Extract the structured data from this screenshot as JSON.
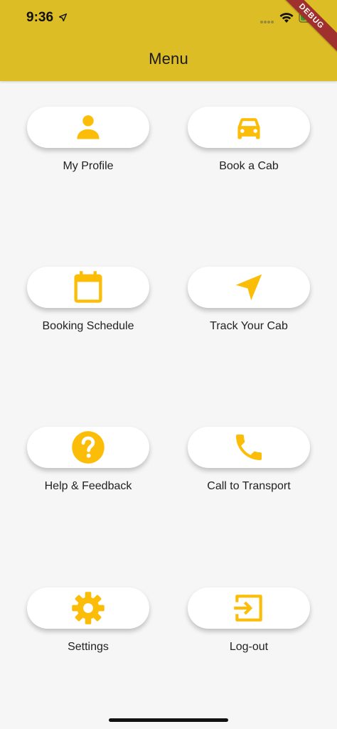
{
  "status_bar": {
    "time": "9:36"
  },
  "app_bar": {
    "title": "Menu"
  },
  "debug_ribbon": "DEBUG",
  "menu": {
    "items": [
      {
        "label": "My Profile",
        "icon": "person-icon"
      },
      {
        "label": "Book a Cab",
        "icon": "car-icon"
      },
      {
        "label": "Booking Schedule",
        "icon": "calendar-icon"
      },
      {
        "label": "Track Your Cab",
        "icon": "navigation-arrow-icon"
      },
      {
        "label": "Help & Feedback",
        "icon": "help-circle-icon"
      },
      {
        "label": "Call to Transport",
        "icon": "phone-icon"
      },
      {
        "label": "Settings",
        "icon": "gear-icon"
      },
      {
        "label": "Log-out",
        "icon": "logout-icon"
      }
    ]
  },
  "colors": {
    "app_bar": "#dcbd26",
    "icon": "#fbbd07",
    "background": "#f6f6f6",
    "debug_ribbon": "#a0302d"
  }
}
